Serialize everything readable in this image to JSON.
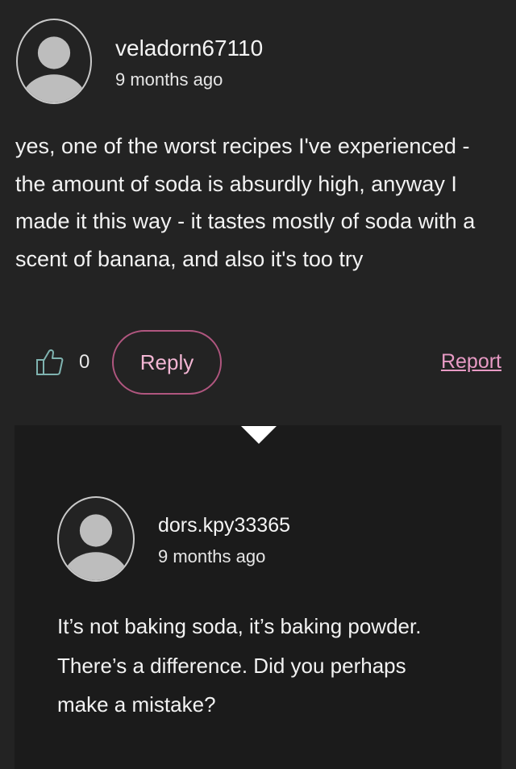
{
  "comment": {
    "username": "veladorn67110",
    "timestamp": "9 months ago",
    "text": "yes, one of the worst recipes I've experienced - the amount of soda is absurdly high, anyway I made it this way - it tastes mostly of soda with a scent of banana, and also it's too try",
    "like_count": "0",
    "reply_label": "Reply",
    "report_label": "Report"
  },
  "reply": {
    "username": "dors.kpy33365",
    "timestamp": "9 months ago",
    "text": "It’s not baking soda, it’s baking powder. There’s a difference. Did you perhaps make a mistake?"
  },
  "icons": {
    "avatar": "user-silhouette-icon",
    "like": "thumbs-up-icon",
    "expand": "caret-down-icon"
  },
  "colors": {
    "background": "#232323",
    "reply_panel": "#1b1b1b",
    "accent_border": "#b0567f",
    "accent_text": "#f3b6d4",
    "link": "#e79ac4",
    "like_icon": "#7fb3b0"
  }
}
